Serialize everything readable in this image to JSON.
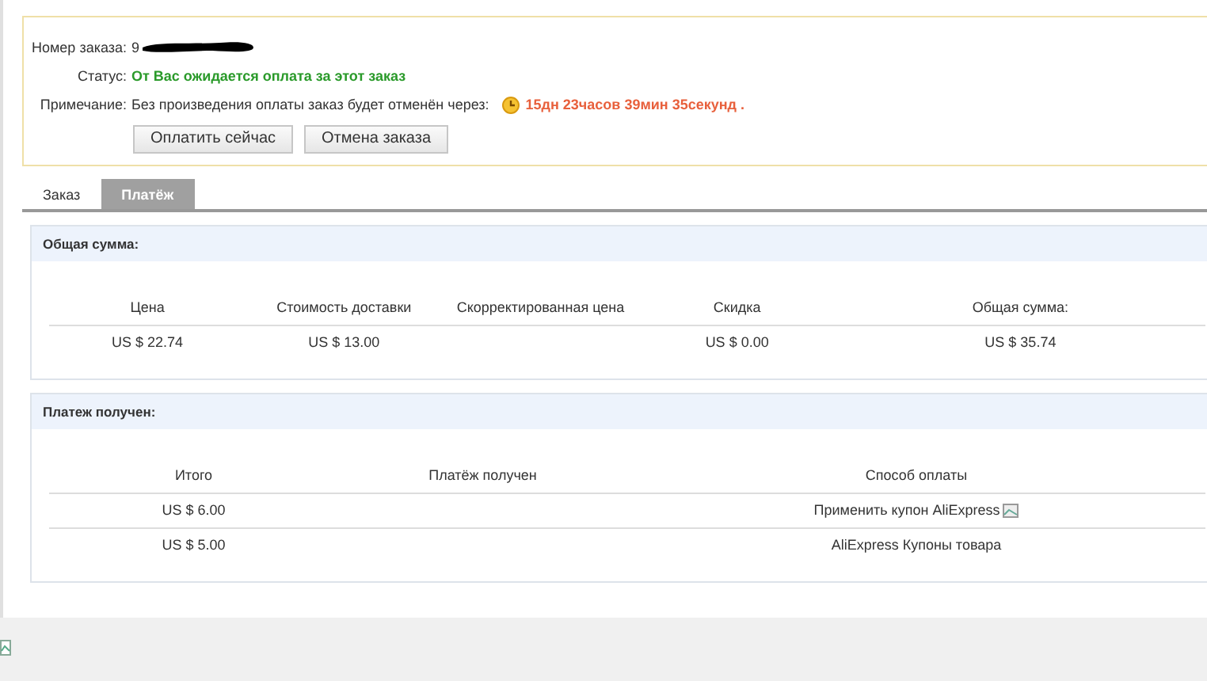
{
  "order": {
    "number_label": "Номер заказа:",
    "number": "9",
    "status_label": "Статус:",
    "status": "От Вас ожидается оплата за этот заказ",
    "note_label": "Примечание:",
    "note": "Без произведения оплаты заказ будет отменён через:",
    "countdown": "15дн 23часов 39мин 35секунд .",
    "buttons": [
      "Оплатить сейчас",
      "Отмена заказа"
    ]
  },
  "tabs": [
    {
      "label": "Заказ",
      "selected": false
    },
    {
      "label": "Платёж",
      "selected": true
    }
  ],
  "sections": [
    {
      "title": "Общая сумма:",
      "columns": [
        "Цена",
        "Стоимость доставки",
        "Скорректированная цена",
        "Скидка",
        "Общая сумма:"
      ],
      "rows": [
        {
          "cells": [
            "US $ 22.74",
            "US $ 13.00",
            "",
            "US $ 0.00",
            "US $ 35.74"
          ],
          "broken_image": false
        }
      ]
    },
    {
      "title": "Платеж получен:",
      "columns": [
        "Итого",
        "Платёж получен",
        "Способ оплаты"
      ],
      "rows": [
        {
          "cells": [
            "US $ 6.00",
            "",
            "Применить купон AliExpress"
          ],
          "broken_image": true
        },
        {
          "cells": [
            "US $ 5.00",
            "",
            "AliExpress Купоны товара"
          ],
          "broken_image": false
        }
      ]
    }
  ]
}
